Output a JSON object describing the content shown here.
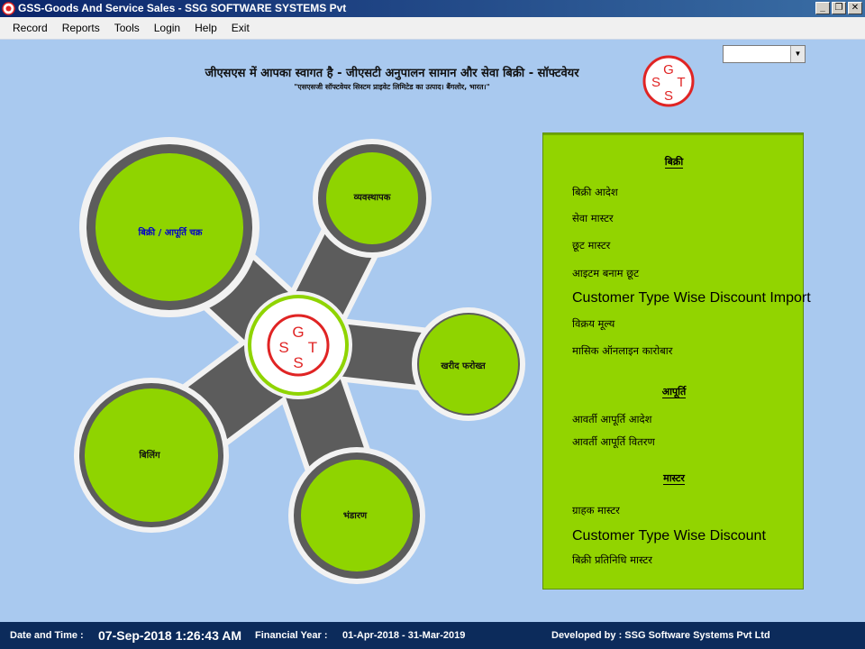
{
  "window": {
    "title": "GSS-Goods And Service Sales - SSG SOFTWARE SYSTEMS Pvt",
    "buttons": {
      "minimize": "_",
      "restore": "❐",
      "close": "✕"
    }
  },
  "menu": [
    {
      "label": "Record"
    },
    {
      "label": "Reports"
    },
    {
      "label": "Tools"
    },
    {
      "label": "Login"
    },
    {
      "label": "Help"
    },
    {
      "label": "Exit"
    }
  ],
  "header": {
    "welcome": "जीएसएस में आपका स्वागत है - जीएसटी अनुपालन सामान और सेवा बिक्री - सॉफ्टवेयर",
    "subtitle": "\"एसएसजी सॉफ्टवेयर सिस्टम प्राइवेट लिमिटेड का उत्पाद। बैंगलोर, भारत।\"",
    "dropdown_value": "",
    "dropdown_arrow": "▼"
  },
  "logo": {
    "letters": [
      "G",
      "S",
      "T",
      "S"
    ]
  },
  "hub": {
    "nodes": [
      {
        "label": "बिक्री / आपूर्ति चक्र"
      },
      {
        "label": "व्यवस्थापक"
      },
      {
        "label": "खरीद फरोख्त"
      },
      {
        "label": "बिलिंग"
      },
      {
        "label": "भंडारण"
      }
    ]
  },
  "panel": {
    "sections": [
      {
        "heading": "बिक्री",
        "items": [
          {
            "label": "बिक्री आदेश"
          },
          {
            "label": "सेवा मास्टर"
          },
          {
            "label": "छूट मास्टर"
          },
          {
            "label": "आइटम बनाम छूट"
          },
          {
            "label": "Customer Type Wise Discount Import"
          },
          {
            "label": "विक्रय मूल्य"
          },
          {
            "label": "मासिक ऑनलाइन कारोबार"
          }
        ]
      },
      {
        "heading": "आपूर्ति",
        "items": [
          {
            "label": "आवर्ती आपूर्ति आदेश"
          },
          {
            "label": "आवर्ती आपूर्ति वितरण"
          }
        ]
      },
      {
        "heading": "मास्टर",
        "items": [
          {
            "label": "ग्राहक मास्टर"
          },
          {
            "label": "Customer Type Wise Discount"
          },
          {
            "label": "बिक्री प्रतिनिधि मास्टर"
          }
        ]
      }
    ]
  },
  "status": {
    "datetime_label": "Date and Time :",
    "datetime_value": "07-Sep-2018 1:26:43 AM",
    "fy_label": "Financial Year :",
    "fy_value": "01-Apr-2018 - 31-Mar-2019",
    "developer": "Developed by : SSG Software Systems Pvt Ltd"
  },
  "colors": {
    "background": "#a9c9ef",
    "hub_green": "#8fd400",
    "hub_arm": "#5c5c5c",
    "logo_red": "#e02424",
    "statusbar": "#0c2b5b"
  }
}
